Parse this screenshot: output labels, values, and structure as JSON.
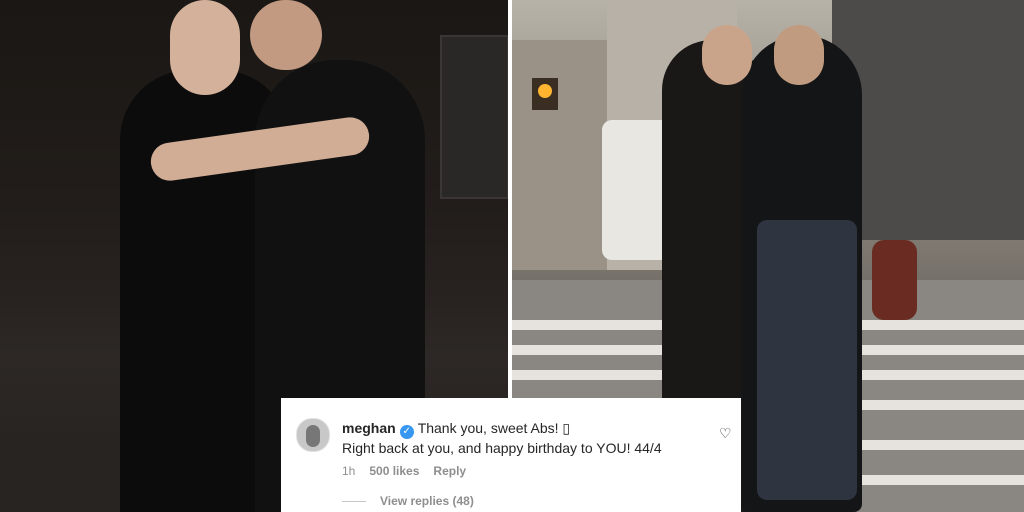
{
  "comment": {
    "username": "meghan",
    "verified_icon": "verified-badge-icon",
    "text_line1": "Thank you, sweet Abs! ▯",
    "text_line2": "Right back at you, and happy birthday to YOU! 44/4",
    "time": "1h",
    "likes": "500 likes",
    "reply_label": "Reply",
    "view_replies": "View replies (48)",
    "like_icon": "heart-icon"
  },
  "colors": {
    "verified_blue": "#3897f0",
    "meta_gray": "#8e8e8e",
    "text_dark": "#262626"
  }
}
